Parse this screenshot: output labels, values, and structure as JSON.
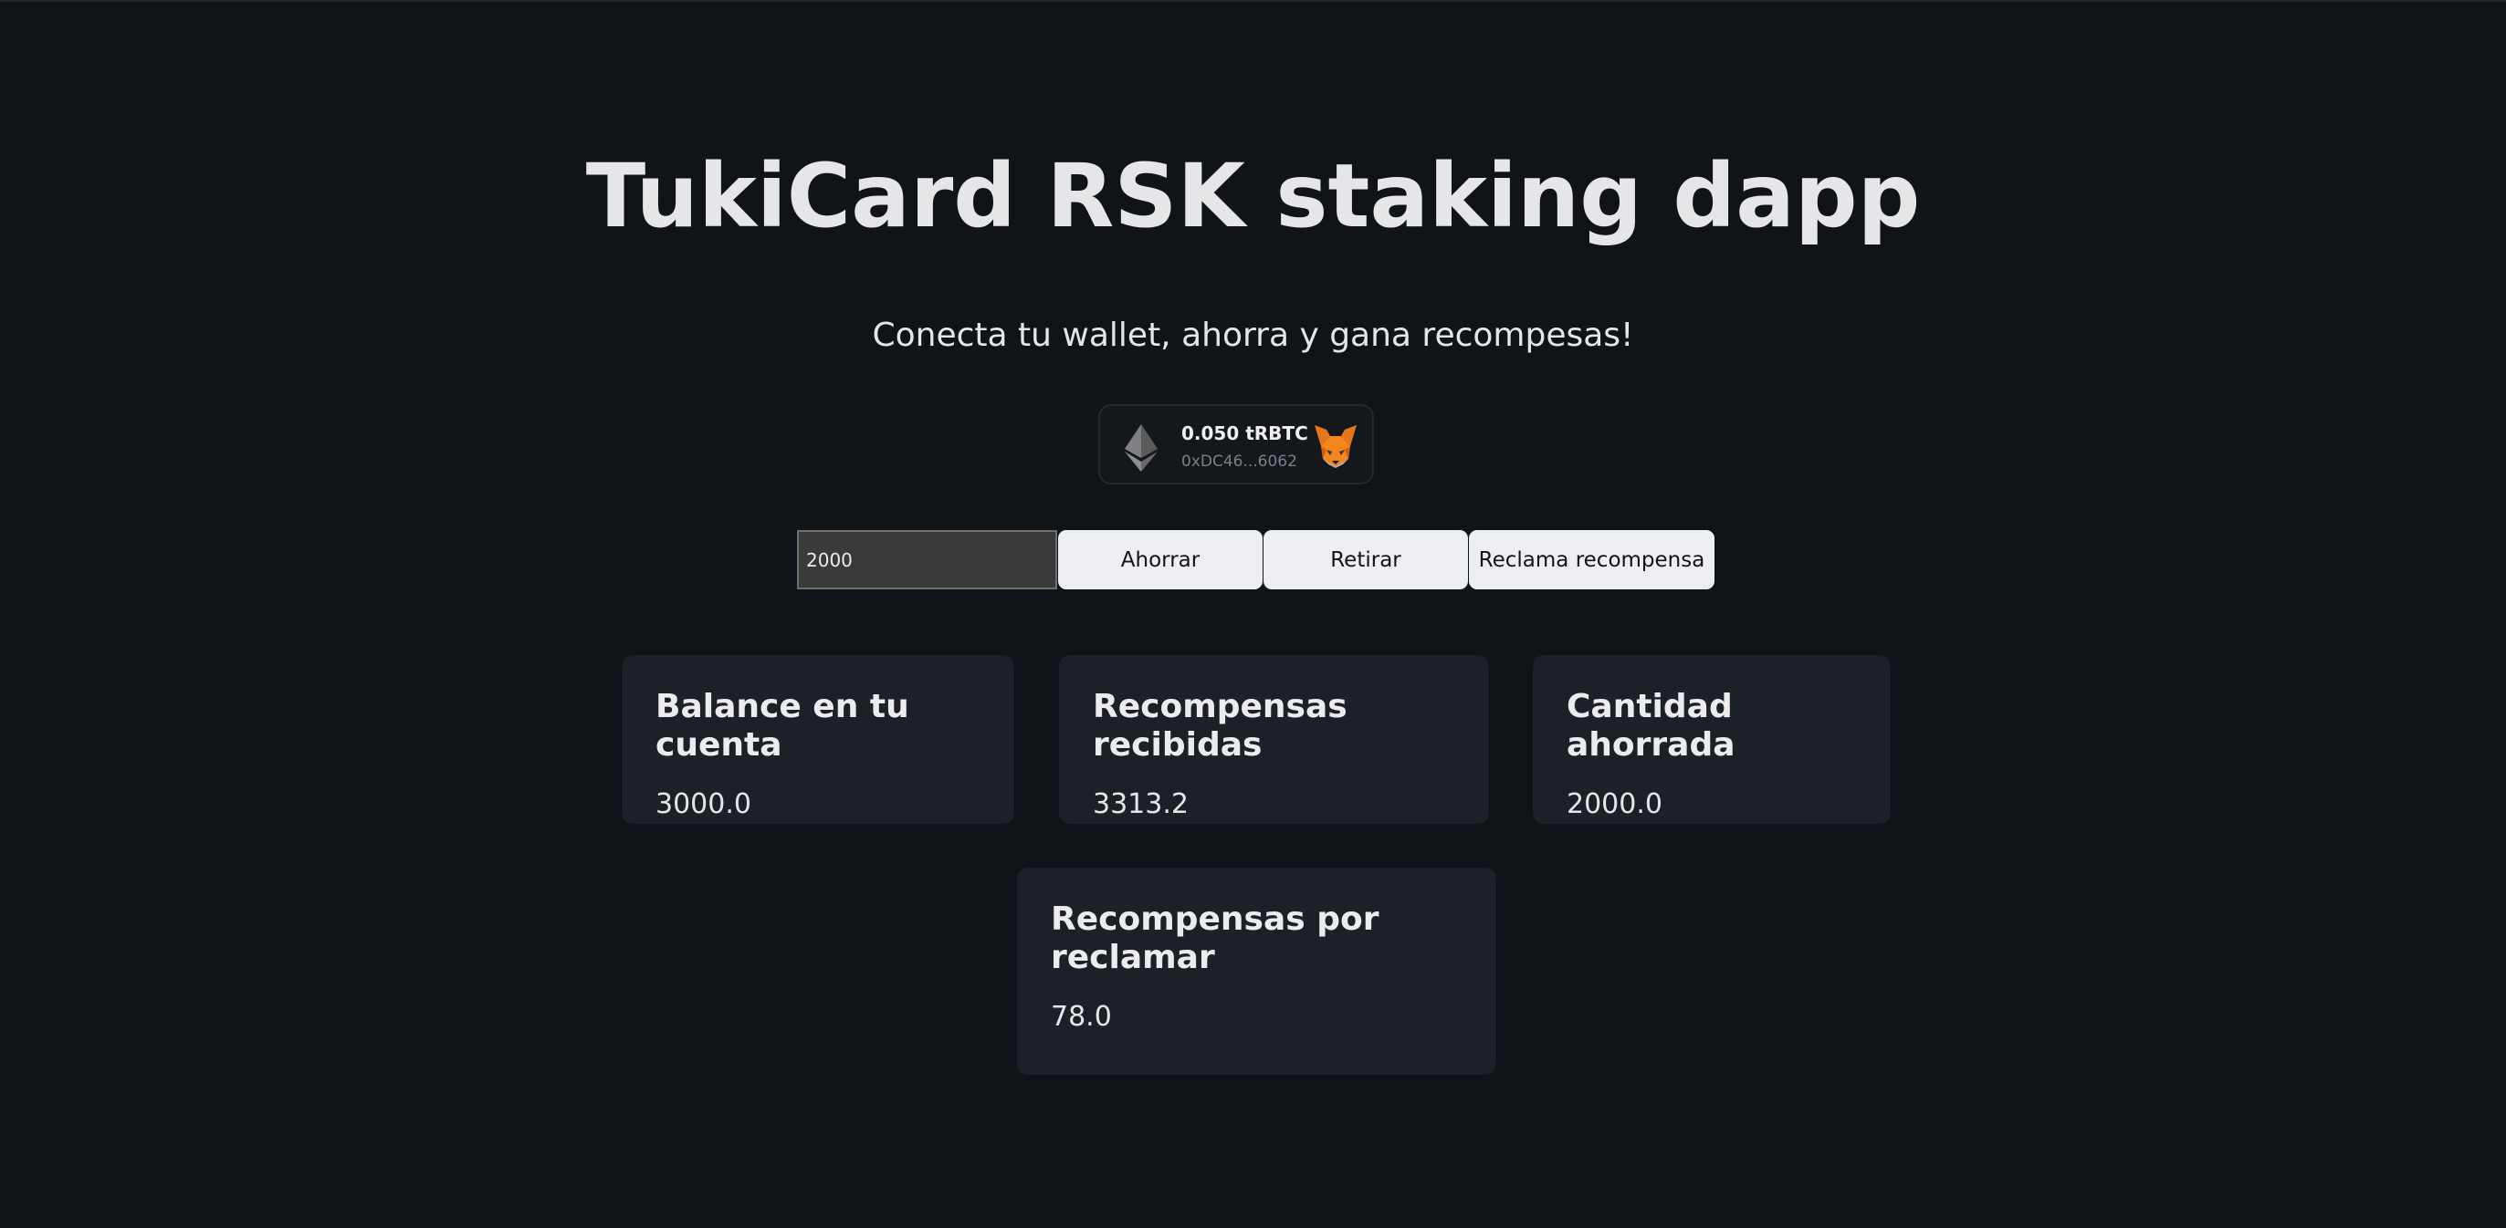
{
  "header": {
    "title": "TukiCard RSK staking dapp",
    "subtitle": "Conecta tu wallet, ahorra y gana recompesas!"
  },
  "wallet": {
    "balance": "0.050 tRBTC",
    "address": "0xDC46...6062",
    "network_icon": "ethereum-icon",
    "wallet_icon": "metamask-fox-icon"
  },
  "controls": {
    "amount_value": "2000",
    "save_label": "Ahorrar",
    "withdraw_label": "Retirar",
    "claim_label": "Reclama recompensa"
  },
  "cards": {
    "balance": {
      "title": "Balance en tu cuenta",
      "value": "3000.0"
    },
    "rewards_received": {
      "title": "Recompensas recibidas",
      "value": "3313.2"
    },
    "amount_saved": {
      "title": "Cantidad ahorrada",
      "value": "2000.0"
    },
    "rewards_pending": {
      "title": "Recompensas por reclamar",
      "value": "78.0"
    }
  },
  "colors": {
    "background": "#101317",
    "card_background": "#1c2027",
    "button_background": "#eceef2",
    "metamask_orange": "#e2761b"
  }
}
